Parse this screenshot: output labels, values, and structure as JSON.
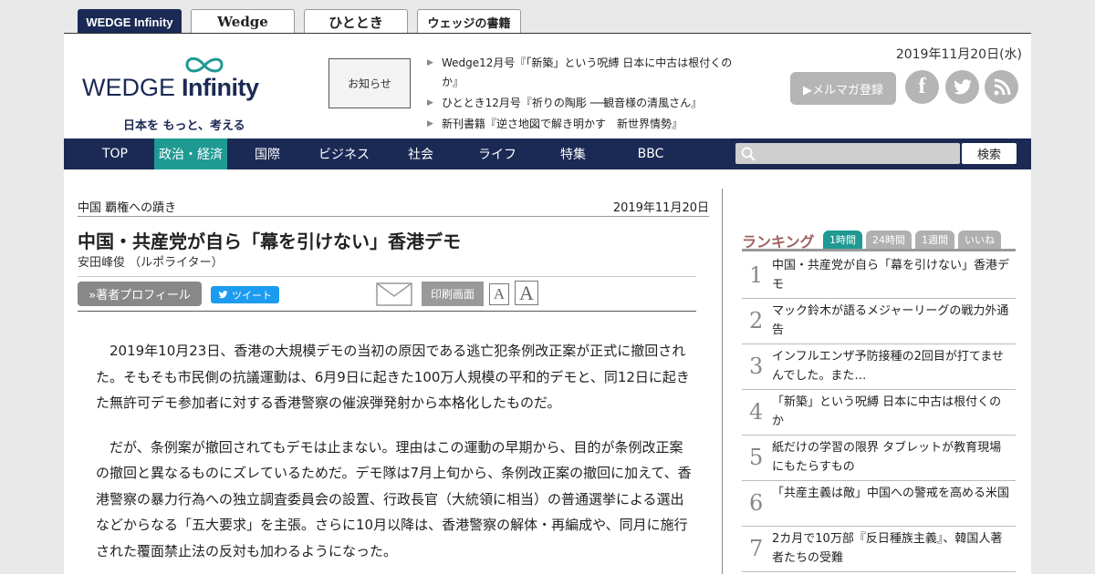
{
  "site_tabs": [
    "WEDGE Infinity",
    "Wedge",
    "ひととき",
    "ウェッジの書籍"
  ],
  "logo": {
    "brand": "WEDGE",
    "brand2": "Infinity",
    "tagline": "日本を もっと、考える"
  },
  "notice": {
    "box_label": "お知らせ",
    "items": [
      "Wedge12月号『「新築」という呪縛 日本に中古は根付くのか』",
      "ひととき12月号『祈りの陶彫 ──観音様の清風さん』",
      "新刊書籍『逆さ地図で解き明かす　新世界情勢』"
    ]
  },
  "header": {
    "date": "2019年11月20日(水)",
    "mailmag_label": "▶メルマガ登録"
  },
  "icons": {
    "facebook": "facebook-icon",
    "twitter": "twitter-icon",
    "rss": "rss-icon",
    "search": "search-icon",
    "mail": "mail-icon"
  },
  "nav": {
    "items": [
      "TOP",
      "政治・経済",
      "国際",
      "ビジネス",
      "社会",
      "ライフ",
      "特集",
      "BBC"
    ],
    "active": "政治・経済",
    "search_button": "検索"
  },
  "article": {
    "series": "中国 覇権への蹟き",
    "date": "2019年11月20日",
    "title": "中国・共産党が自ら「幕を引けない」香港デモ",
    "author": "安田峰俊 （ルポライター）",
    "profile_button": "»著者プロフィール",
    "tweet_button": "ツイート",
    "print_button": "印刷画面",
    "font_small": "A",
    "font_large": "A",
    "paragraphs": [
      "2019年10月23日、香港の大規模デモの当初の原因である逃亡犯条例改正案が正式に撤回された。そもそも市民側の抗議運動は、6月9日に起きた100万人規模の平和的デモと、同12日に起きた無許可デモ参加者に対する香港警察の催涙弾発射から本格化したものだ。",
      "だが、条例案が撤回されてもデモは止まない。理由はこの運動の早期から、目的が条例改正案の撤回と異なるものにズレているためだ。デモ隊は7月上旬から、条例改正案の撤回に加えて、香港警察の暴力行為への独立調査委員会の設置、行政長官（大統領に相当）の普通選挙による選出などからなる「五大要求」を主張。さらに10月以降は、香港警察の解体・再編成や、同月に施行された覆面禁止法の反対も加わるようになった。"
    ]
  },
  "ranking": {
    "title": "ランキング",
    "tabs": [
      "1時間",
      "24時間",
      "1週間",
      "いいね"
    ],
    "active_tab": "1時間",
    "items": [
      {
        "rank": "1",
        "text": "中国・共産党が自ら「幕を引けない」香港デモ"
      },
      {
        "rank": "2",
        "text": "マック鈴木が語るメジャーリーグの戦力外通告"
      },
      {
        "rank": "3",
        "text": "インフルエンザ予防接種の2回目が打てませんでした。また…"
      },
      {
        "rank": "4",
        "text": "「新築」という呪縛 日本に中古は根付くのか"
      },
      {
        "rank": "5",
        "text": "紙だけの学習の限界 タブレットが教育現場にもたらすもの"
      },
      {
        "rank": "6",
        "text": "「共産主義は敵」中国への警戒を高める米国"
      },
      {
        "rank": "7",
        "text": "2カ月で10万部『反日種族主義』、韓国人著者たちの受難"
      }
    ]
  }
}
